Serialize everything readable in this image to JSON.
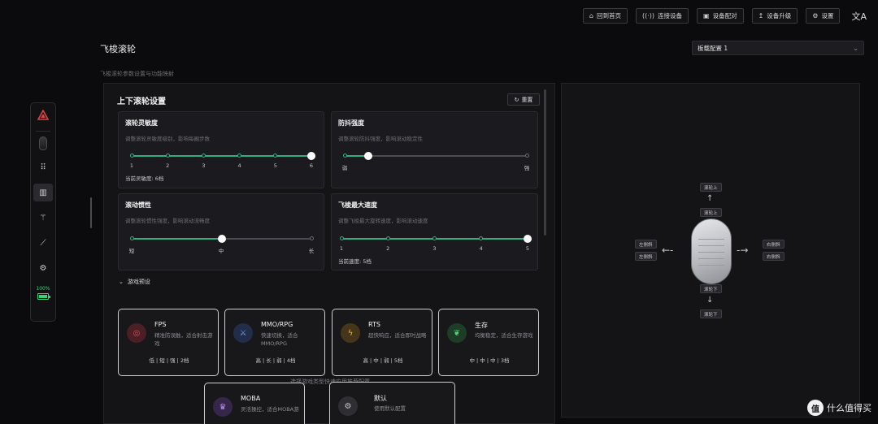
{
  "topbar": {
    "buttons": [
      {
        "label": "回到首页",
        "icon": "home-icon"
      },
      {
        "label": "连接设备",
        "icon": "signal-icon"
      },
      {
        "label": "设备配对",
        "icon": "pair-icon"
      },
      {
        "label": "设备升级",
        "icon": "upgrade-icon"
      },
      {
        "label": "设置",
        "icon": "gear-icon"
      }
    ],
    "lang_icon": "文A"
  },
  "page": {
    "title": "飞梭滚轮",
    "subtitle": "飞梭滚轮参数设置与功能映射",
    "config_select": "板载配置 1"
  },
  "sidebar": {
    "battery": "100%"
  },
  "section": {
    "title": "上下滚轮设置",
    "reset_label": "重置"
  },
  "sensitivity": {
    "title": "滚轮灵敏度",
    "desc": "调整滚轮灵敏度级别，影响每圈步数",
    "ticks": [
      "1",
      "2",
      "3",
      "4",
      "5",
      "6"
    ],
    "value": 6,
    "current": "当前灵敏度: 6档"
  },
  "antishake": {
    "title": "防抖强度",
    "desc": "调整滚轮防抖强度，影响滚动稳定性",
    "min_label": "弱",
    "max_label": "强",
    "level": 0.13
  },
  "inertia": {
    "title": "滚动惯性",
    "desc": "调整滚轮惯性强度，影响滚动流畅度",
    "labels": [
      "短",
      "中",
      "长"
    ],
    "level": 0.5
  },
  "maxspeed": {
    "title": "飞梭最大速度",
    "desc": "调整飞梭最大旋转速度，影响滚动速度",
    "ticks": [
      "1",
      "2",
      "3",
      "4",
      "5"
    ],
    "value": 5,
    "current": "当前速度: 5档"
  },
  "presets": {
    "toggle_label": "游戏预设",
    "hint": "选择游戏类型快速应用推荐配置",
    "items": [
      {
        "name": "FPS",
        "desc": "精准防误触，适合射击游戏",
        "stats": "低 | 短 | 强 | 2档",
        "icon": "target-icon",
        "color": "#e24a5a"
      },
      {
        "name": "MMO/RPG",
        "desc": "快速切换，适合MMO/RPG",
        "stats": "高 | 长 | 弱 | 4档",
        "icon": "swords-icon",
        "color": "#5a7ad8"
      },
      {
        "name": "RTS",
        "desc": "超快响应，适合即时战略",
        "stats": "高 | 中 | 弱 | 5档",
        "icon": "bolt-icon",
        "color": "#e0a030"
      },
      {
        "name": "生存",
        "desc": "均衡稳定，适合生存游戏",
        "stats": "中 | 中 | 中 | 3档",
        "icon": "leaf-icon",
        "color": "#3aa860"
      },
      {
        "name": "MOBA",
        "desc": "灵活操控，适合MOBA游",
        "stats": "",
        "icon": "hero-icon",
        "color": "#9a70d8"
      },
      {
        "name": "默认",
        "desc": "使用默认配置",
        "stats": "",
        "icon": "gear-icon",
        "color": "#8a8a90"
      }
    ]
  },
  "mouse_map": {
    "scroll_up_top": "滚轮上",
    "scroll_up": "滚轮上",
    "scroll_down": "滚轮下",
    "scroll_down_bottom": "滚轮下",
    "left_top": "左侧斜",
    "left_bottom": "左侧斜",
    "right_top": "右侧斜",
    "right_bottom": "右侧斜"
  },
  "watermark": {
    "circle": "值",
    "text": "什么值得买"
  }
}
